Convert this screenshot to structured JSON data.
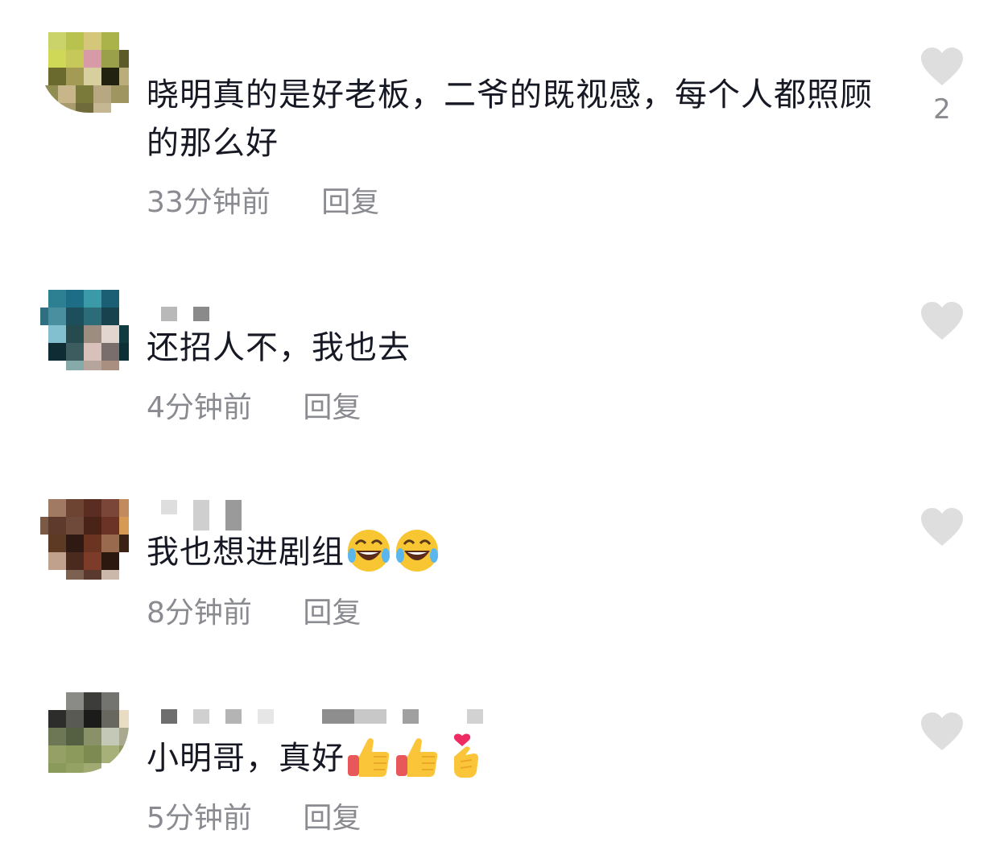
{
  "colors": {
    "text": "#161823",
    "meta": "#8a8b91",
    "heart": "#dedede"
  },
  "comments": [
    {
      "text": "晓明真的是好老板，二爷的既视感，每个人都照顾的那么好",
      "time": "33分钟前",
      "reply_label": "回复",
      "like_count": "2",
      "emojis": []
    },
    {
      "text": "还招人不，我也去",
      "time": "4分钟前",
      "reply_label": "回复",
      "like_count": "",
      "emojis": []
    },
    {
      "text": "我也想进剧组",
      "time": "8分钟前",
      "reply_label": "回复",
      "like_count": "",
      "emojis": [
        "laughing-crying-emoji",
        "laughing-crying-emoji"
      ]
    },
    {
      "text": "小明哥，真好",
      "time": "5分钟前",
      "reply_label": "回复",
      "like_count": "",
      "emojis": [
        "thumbs-up-emoji",
        "thumbs-up-emoji",
        "finger-heart-emoji"
      ]
    }
  ]
}
